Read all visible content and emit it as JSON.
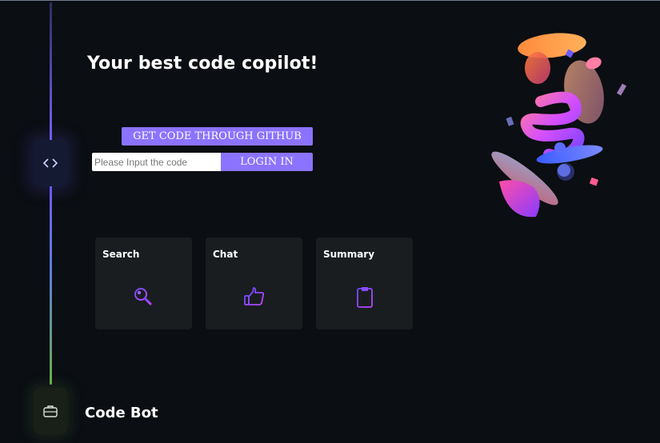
{
  "header": {
    "title": "Your best code copilot!"
  },
  "auth": {
    "github_button_label": "GET CODE THROUGH GITHUB",
    "code_input_value": "",
    "code_input_placeholder": "Please Input the code",
    "login_button_label": "LOGIN IN"
  },
  "features": [
    {
      "label": "Search",
      "icon": "search-icon"
    },
    {
      "label": "Chat",
      "icon": "thumbs-up-icon"
    },
    {
      "label": "Summary",
      "icon": "clipboard-icon"
    }
  ],
  "sidebar": {
    "nodes": [
      {
        "icon": "code-brackets-icon"
      },
      {
        "icon": "briefcase-icon"
      }
    ]
  },
  "footer": {
    "brand_label": "Code Bot"
  },
  "colors": {
    "background": "#0b0e12",
    "accent": "#8c73ff",
    "card": "#191d20",
    "icon_purple": "#8a4bff",
    "timeline_green": "#68b04a"
  }
}
